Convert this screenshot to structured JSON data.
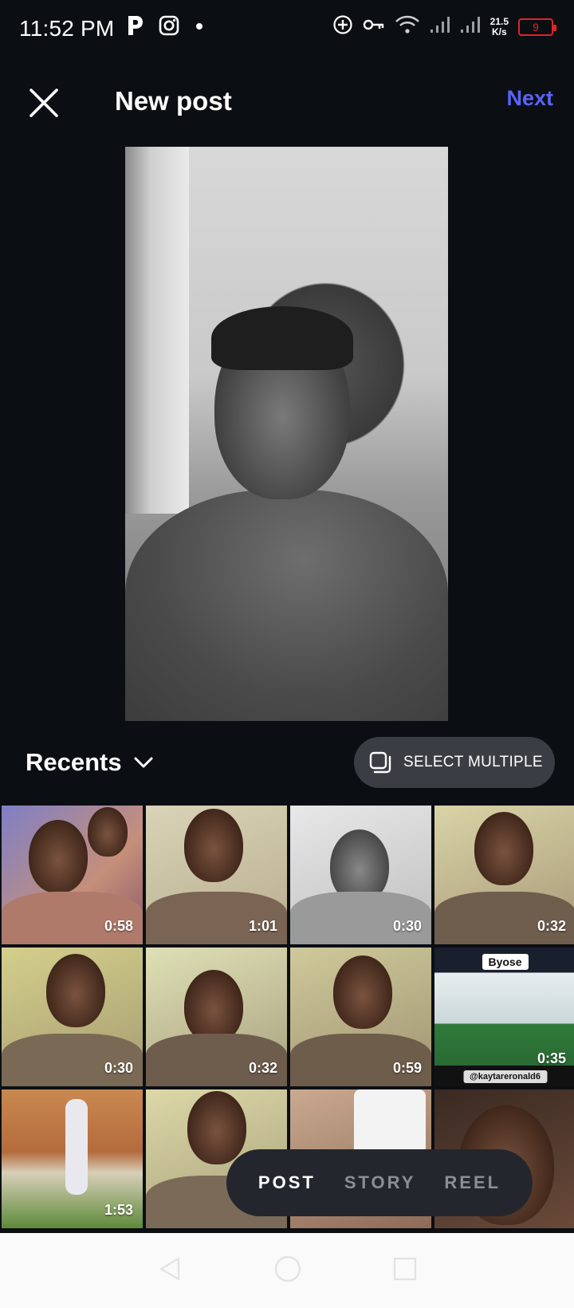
{
  "status_bar": {
    "time": "11:52 PM",
    "speed_value": "21.5",
    "speed_unit": "K/s",
    "battery": "9",
    "icons": [
      "p-app-icon",
      "instagram-icon",
      "dot-icon",
      "add-circle-icon",
      "key-icon",
      "wifi-icon",
      "signal-icon",
      "signal-icon-2"
    ]
  },
  "header": {
    "title": "New post",
    "next_label": "Next",
    "close_icon": "close-icon",
    "accent_color": "#5a63f5"
  },
  "gallery": {
    "album_label": "Recents",
    "select_multiple_label": "SELECT MULTIPLE",
    "thumbnails": [
      {
        "duration": "0:58"
      },
      {
        "duration": "1:01"
      },
      {
        "duration": "0:30"
      },
      {
        "duration": "0:32"
      },
      {
        "duration": "0:30"
      },
      {
        "duration": "0:32"
      },
      {
        "duration": "0:59"
      },
      {
        "duration": "0:35",
        "top_label": "Byose",
        "bottom_label": "@kaytareronald6"
      },
      {
        "duration": "1:53"
      },
      {
        "duration": ""
      },
      {
        "duration": ""
      },
      {
        "duration": ""
      }
    ]
  },
  "modes": {
    "items": [
      "POST",
      "STORY",
      "REEL"
    ],
    "active": "POST"
  },
  "nav": {
    "icons": [
      "back-icon",
      "home-icon",
      "recents-icon"
    ]
  }
}
